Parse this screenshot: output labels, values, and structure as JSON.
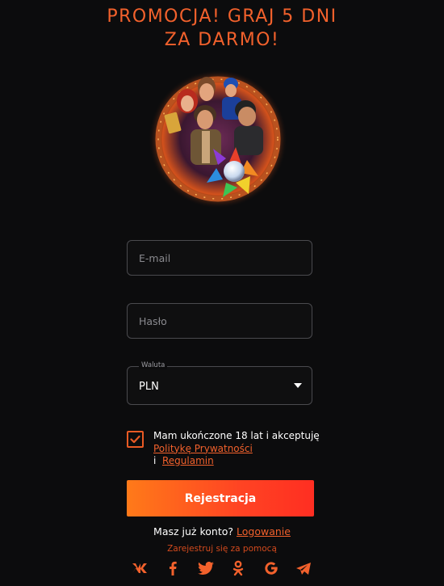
{
  "promo": {
    "line1": "PROMOCJA! GRAJ 5 DNI",
    "line2": "ZA DARMO!"
  },
  "form": {
    "email_placeholder": "E-mail",
    "password_placeholder": "Hasło",
    "currency_label": "Waluta",
    "currency_value": "PLN",
    "consent_age_text": "Mam ukończone 18 lat i akceptuję",
    "privacy_link": "Politykę Prywatności",
    "and_text": "i",
    "terms_link": "Regulamin",
    "consent_checked": true,
    "register_button": "Rejestracja"
  },
  "login": {
    "prompt": "Masz już konto?",
    "link": "Logowanie"
  },
  "social": {
    "label": "Zarejestruj się za pomocą",
    "icons": [
      "vk-icon",
      "facebook-icon",
      "twitter-icon",
      "odnoklassniki-icon",
      "google-icon",
      "telegram-icon"
    ]
  },
  "colors": {
    "accent": "#f2612c",
    "button_start": "#ff7a19",
    "button_end": "#ff2e22",
    "background": "#0c0c0d"
  }
}
